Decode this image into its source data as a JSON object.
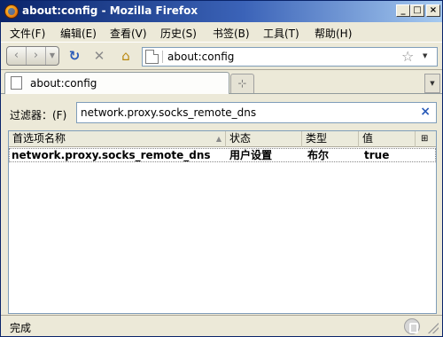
{
  "window": {
    "title": "about:config - Mozilla Firefox",
    "controls": {
      "minimize": "_",
      "maximize": "□",
      "close": "×"
    }
  },
  "menu": [
    {
      "label": "文件(F)"
    },
    {
      "label": "编辑(E)"
    },
    {
      "label": "查看(V)"
    },
    {
      "label": "历史(S)"
    },
    {
      "label": "书签(B)"
    },
    {
      "label": "工具(T)"
    },
    {
      "label": "帮助(H)"
    }
  ],
  "navbar": {
    "back_glyph": "‹",
    "forward_glyph": "›",
    "dropdown_glyph": "▼",
    "reload_glyph": "↻",
    "stop_glyph": "✕",
    "home_glyph": "⌂",
    "url": "about:config",
    "star_glyph": "☆",
    "url_dropdown_glyph": "▼"
  },
  "tabs": [
    {
      "label": "about:config",
      "active": true
    }
  ],
  "tabstrip": {
    "new_tab_glyph": "⊹",
    "list_glyph": "▼"
  },
  "filter": {
    "label": "过滤器：(F)",
    "value": "network.proxy.socks_remote_dns",
    "clear_glyph": "×"
  },
  "table": {
    "columns": [
      {
        "label": "首选项名称"
      },
      {
        "label": "状态"
      },
      {
        "label": "类型"
      },
      {
        "label": "值"
      }
    ],
    "column_picker_glyph": "⊞",
    "sort_glyph": "▲",
    "rows": [
      {
        "name": "network.proxy.socks_remote_dns",
        "status": "用户设置",
        "type": "布尔",
        "value": "true"
      }
    ]
  },
  "statusbar": {
    "text": "完成"
  },
  "colors": {
    "titlebar_start": "#0a246a",
    "titlebar_end": "#a6caf0",
    "chrome": "#ece9d8",
    "accent": "#2a5bb8"
  }
}
